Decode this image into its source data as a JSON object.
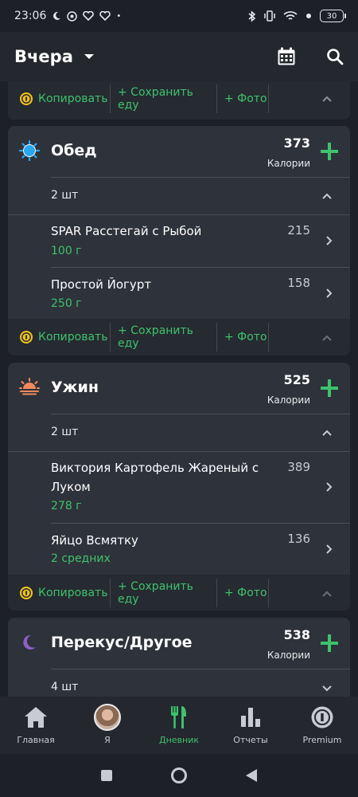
{
  "status_bar": {
    "time": "23:06",
    "battery": "30"
  },
  "header": {
    "date_label": "Вчера"
  },
  "actions": {
    "copy": "Копировать",
    "save_food": "+ Сохранить еду",
    "photo": "+ Фото"
  },
  "meals": [
    {
      "name": "Обед",
      "calories": "373",
      "calories_label": "Калории",
      "count": "2 шт",
      "items": [
        {
          "name": "SPAR Расстегай с Рыбой",
          "amount": "100 г",
          "calories": "215"
        },
        {
          "name": "Простой Йогурт",
          "amount": "250 г",
          "calories": "158"
        }
      ]
    },
    {
      "name": "Ужин",
      "calories": "525",
      "calories_label": "Калории",
      "count": "2 шт",
      "items": [
        {
          "name": "Виктория Картофель Жареный с Луком",
          "amount": "278 г",
          "calories": "389"
        },
        {
          "name": "Яйцо Всмятку",
          "amount": "2 средних",
          "calories": "136"
        }
      ]
    },
    {
      "name": "Перекус/Другое",
      "calories": "538",
      "calories_label": "Калории",
      "count": "4 шт",
      "items": []
    }
  ],
  "bottom_nav": [
    {
      "label": "Главная",
      "icon": "home-icon"
    },
    {
      "label": "Я",
      "icon": "avatar"
    },
    {
      "label": "Дневник",
      "icon": "diary-icon",
      "active": true
    },
    {
      "label": "Отчеты",
      "icon": "reports-icon"
    },
    {
      "label": "Premium",
      "icon": "premium-icon"
    }
  ],
  "colors": {
    "accent": "#3ec26d",
    "background": "#1d2026",
    "card": "#2e323a",
    "action_bar": "#262a31"
  }
}
